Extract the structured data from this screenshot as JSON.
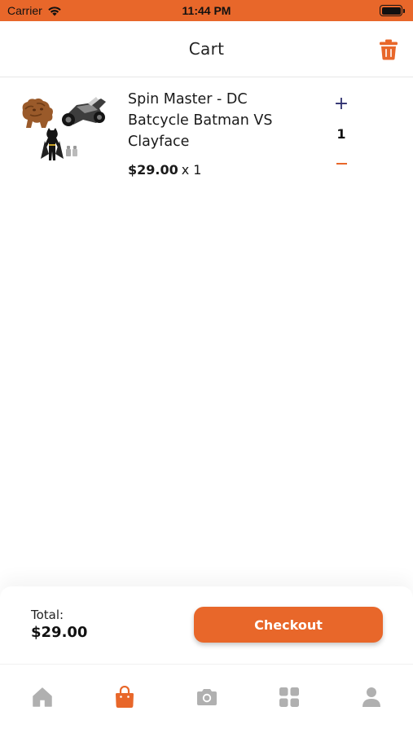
{
  "status_bar": {
    "carrier": "Carrier",
    "time": "11:44 PM"
  },
  "header": {
    "title": "Cart",
    "trash_icon": "trash-icon"
  },
  "cart": {
    "items": [
      {
        "name": "Spin Master - DC Batcycle Batman VS Clayface",
        "price": "$29.00",
        "multiplier": "x 1",
        "quantity": "1",
        "plus_label": "+",
        "image_icon": "product-image"
      }
    ]
  },
  "summary": {
    "total_label": "Total:",
    "total_value": "$29.00",
    "checkout_label": "Checkout"
  },
  "tab_bar": {
    "tabs": [
      {
        "icon": "home-icon",
        "active": false
      },
      {
        "icon": "shopping-bag-icon",
        "active": true
      },
      {
        "icon": "camera-icon",
        "active": false
      },
      {
        "icon": "grid-icon",
        "active": false
      },
      {
        "icon": "user-icon",
        "active": false
      }
    ]
  },
  "colors": {
    "accent": "#e8672a",
    "plus": "#2d2f6e",
    "inactive_tab": "#b0b0b0"
  }
}
